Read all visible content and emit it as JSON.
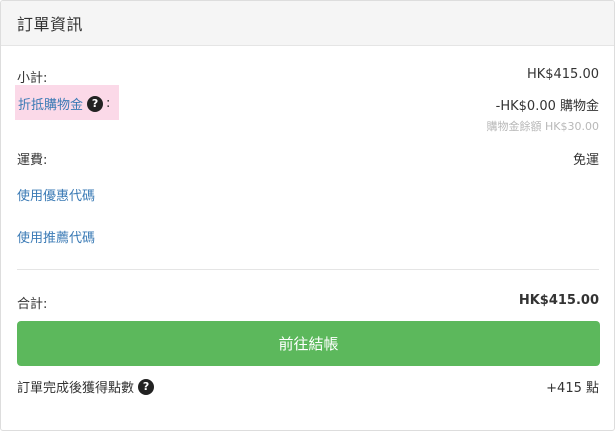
{
  "header": {
    "title": "訂單資訊"
  },
  "subtotal": {
    "label": "小計:",
    "value": "HK$415.00"
  },
  "credit": {
    "label": "折抵購物金",
    "colon": ":",
    "help_icon": "question-circle-icon",
    "value": "-HK$0.00 購物金",
    "balance": "購物金餘額 HK$30.00"
  },
  "shipping": {
    "label": "運費:",
    "value": "免運"
  },
  "promo_link": "使用優惠代碼",
  "referral_link": "使用推薦代碼",
  "total": {
    "label": "合計:",
    "value": "HK$415.00"
  },
  "checkout_button": "前往結帳",
  "points": {
    "label": "訂單完成後獲得點數",
    "help_icon": "question-circle-icon",
    "value": "+415 點"
  },
  "colors": {
    "checkout_green": "#5cb85c",
    "link_blue": "#3a7ab5",
    "credit_highlight": "#fbd9e8"
  }
}
